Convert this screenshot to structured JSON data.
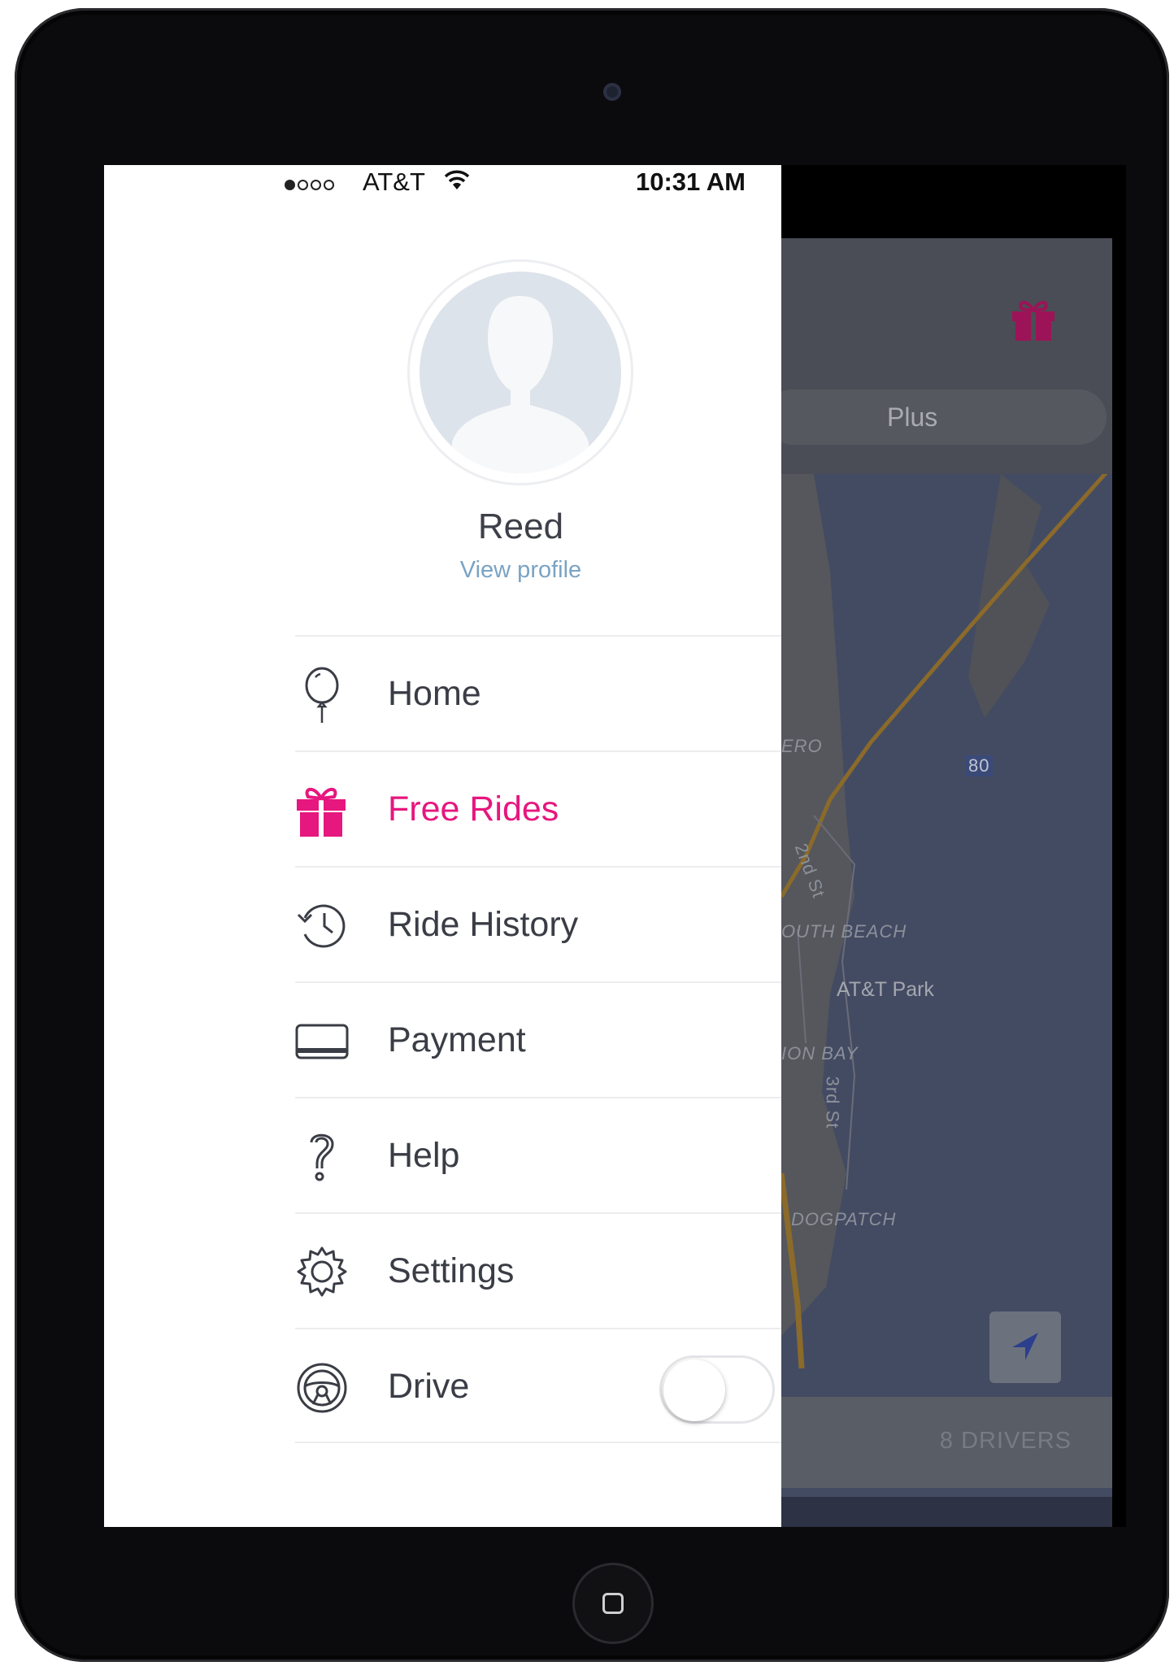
{
  "status_bar": {
    "carrier": "AT&T",
    "time": "10:31 AM"
  },
  "profile": {
    "name": "Reed",
    "link": "View profile"
  },
  "menu": {
    "items": [
      {
        "label": "Home",
        "icon": "balloon-icon"
      },
      {
        "label": "Free Rides",
        "icon": "gift-icon",
        "active": true
      },
      {
        "label": "Ride History",
        "icon": "history-icon"
      },
      {
        "label": "Payment",
        "icon": "credit-card-icon"
      },
      {
        "label": "Help",
        "icon": "question-icon"
      },
      {
        "label": "Settings",
        "icon": "gear-icon"
      },
      {
        "label": "Drive",
        "icon": "steering-wheel-icon",
        "toggle": false
      }
    ]
  },
  "map": {
    "ride_type": "Plus",
    "labels": {
      "embarcadero": "ERO",
      "south_beach": "OUTH BEACH",
      "mission_bay": "ION BAY",
      "dogpatch": "DOGPATCH",
      "street_3rd": "3rd St",
      "street_2nd": "2nd St",
      "park": "AT&T Park",
      "interstate": "80"
    },
    "drivers": "8 DRIVERS"
  },
  "colors": {
    "accent": "#e6177e",
    "link": "#7aa3c4",
    "text": "#3a3d45"
  }
}
